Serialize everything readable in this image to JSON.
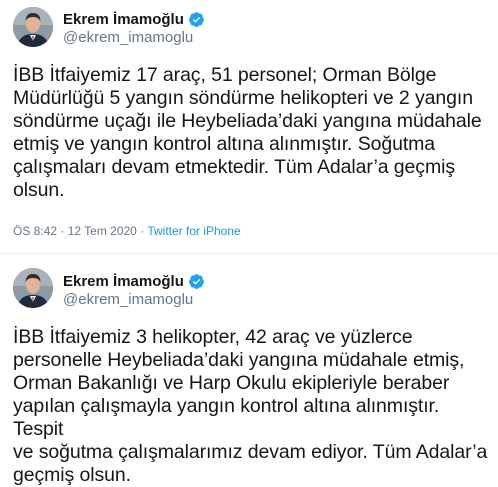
{
  "colors": {
    "text": "#14171a",
    "muted": "#657786",
    "link": "#1b95e0",
    "verified": "#1da1f2",
    "divider": "#e6ecf0"
  },
  "tweets": [
    {
      "display_name": "Ekrem İmamoğlu",
      "handle": "@ekrem_imamoglu",
      "verified_icon": "verified-badge-icon",
      "text": "İBB İtfaiyemiz 17 araç, 51 personel; Orman Bölge\nMüdürlüğü 5 yangın söndürme helikopteri ve 2 yangın\nsöndürme uçağı ile Heybeliada’daki yangına müdahale\netmiş ve yangın kontrol altına alınmıştır. Soğutma\nçalışmaları devam etmektedir. Tüm Adalar’a geçmiş\nolsun.",
      "timestamp": "ÖS 8:42 · 12 Tem 2020 · ",
      "source": "Twitter for iPhone"
    },
    {
      "display_name": "Ekrem İmamoğlu",
      "handle": "@ekrem_imamoglu",
      "verified_icon": "verified-badge-icon",
      "text": "İBB İtfaiyemiz 3 helikopter, 42 araç ve yüzlerce\npersonelle Heybeliada’daki yangına müdahale etmiş,\nOrman Bakanlığı ve Harp Okulu ekipleriyle beraber\nyapılan çalışmayla yangın kontrol altına alınmıştır. Tespit\nve soğutma çalışmalarımız devam ediyor. Tüm Adalar’a\ngeçmiş olsun."
    }
  ]
}
